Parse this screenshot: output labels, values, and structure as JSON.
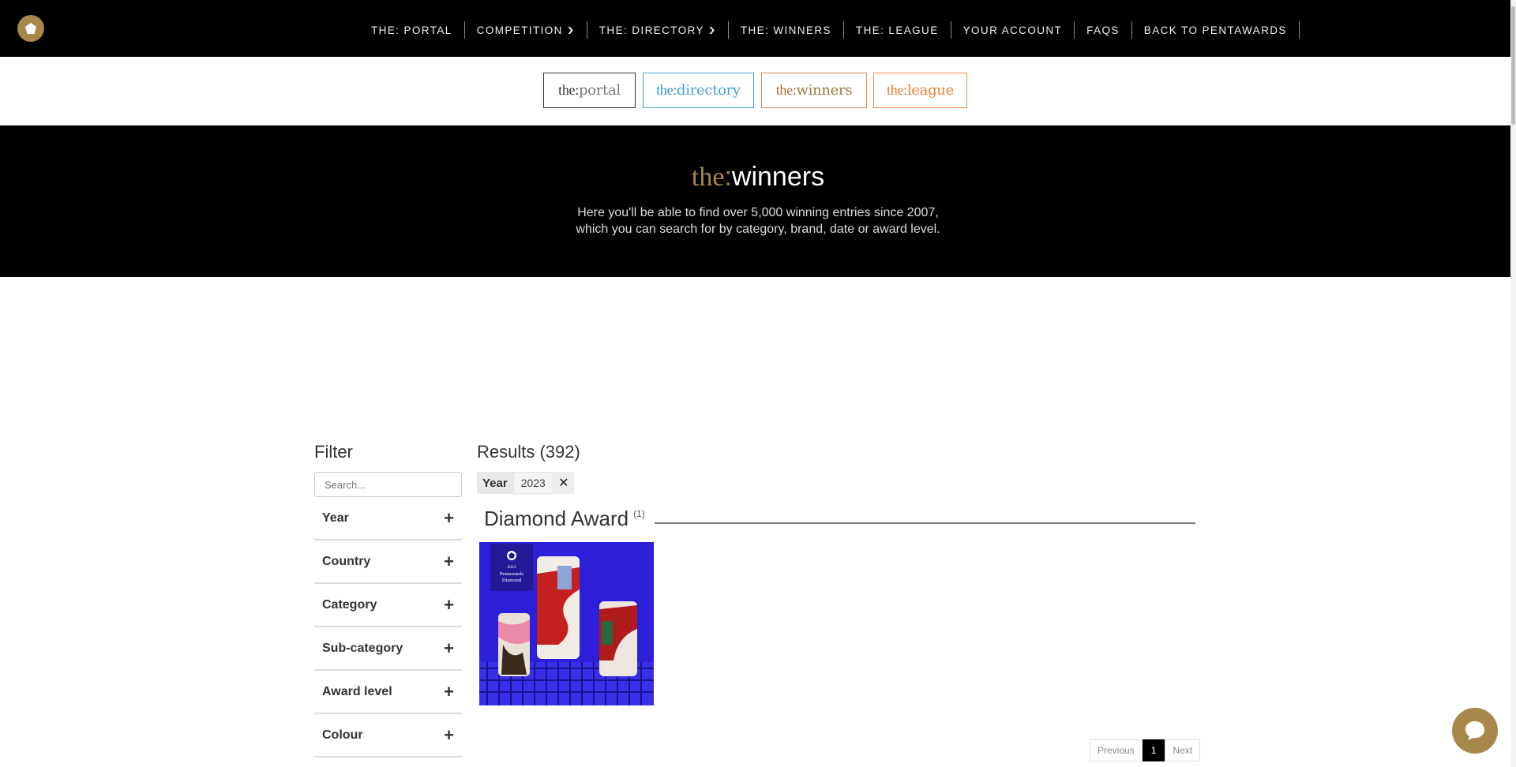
{
  "nav": {
    "items": [
      {
        "label": "THE: PORTAL",
        "dropdown": false
      },
      {
        "label": "COMPETITION",
        "dropdown": true
      },
      {
        "label": "THE: DIRECTORY",
        "dropdown": true
      },
      {
        "label": "THE: WINNERS",
        "dropdown": false
      },
      {
        "label": "THE: LEAGUE",
        "dropdown": false
      },
      {
        "label": "YOUR ACCOUNT",
        "dropdown": false
      },
      {
        "label": "FAQS",
        "dropdown": false
      },
      {
        "label": "BACK TO PENTAWARDS",
        "dropdown": false
      }
    ]
  },
  "brands": {
    "portal": {
      "pre": "the:",
      "post": "portal"
    },
    "directory": {
      "pre": "the:",
      "post": "directory"
    },
    "winners": {
      "pre": "the:",
      "post": "winners"
    },
    "league": {
      "pre": "the:",
      "post": "league"
    }
  },
  "hero": {
    "title_pre": "the",
    "title_colon": ":",
    "title_post": "winners",
    "line1": "Here you'll be able to find over 5,000 winning entries since 2007,",
    "line2": "which you can search for by category, brand, date or award level."
  },
  "filter": {
    "title": "Filter",
    "search_placeholder": "Search...",
    "facets": [
      "Year",
      "Country",
      "Category",
      "Sub-category",
      "Award level",
      "Colour"
    ]
  },
  "results": {
    "title": "Results (392)",
    "chip_label": "Year",
    "chip_value": "2023",
    "section_title": "Diamond Award",
    "section_count": "(1)",
    "card_badge_year": "2023",
    "card_badge_line1": "Pentawards",
    "card_badge_line2": "Diamond"
  },
  "pager": {
    "previous": "Previous",
    "current": "1",
    "next": "Next"
  },
  "colors": {
    "gold": "#a8874a",
    "card_blue": "#2c1ed9"
  }
}
